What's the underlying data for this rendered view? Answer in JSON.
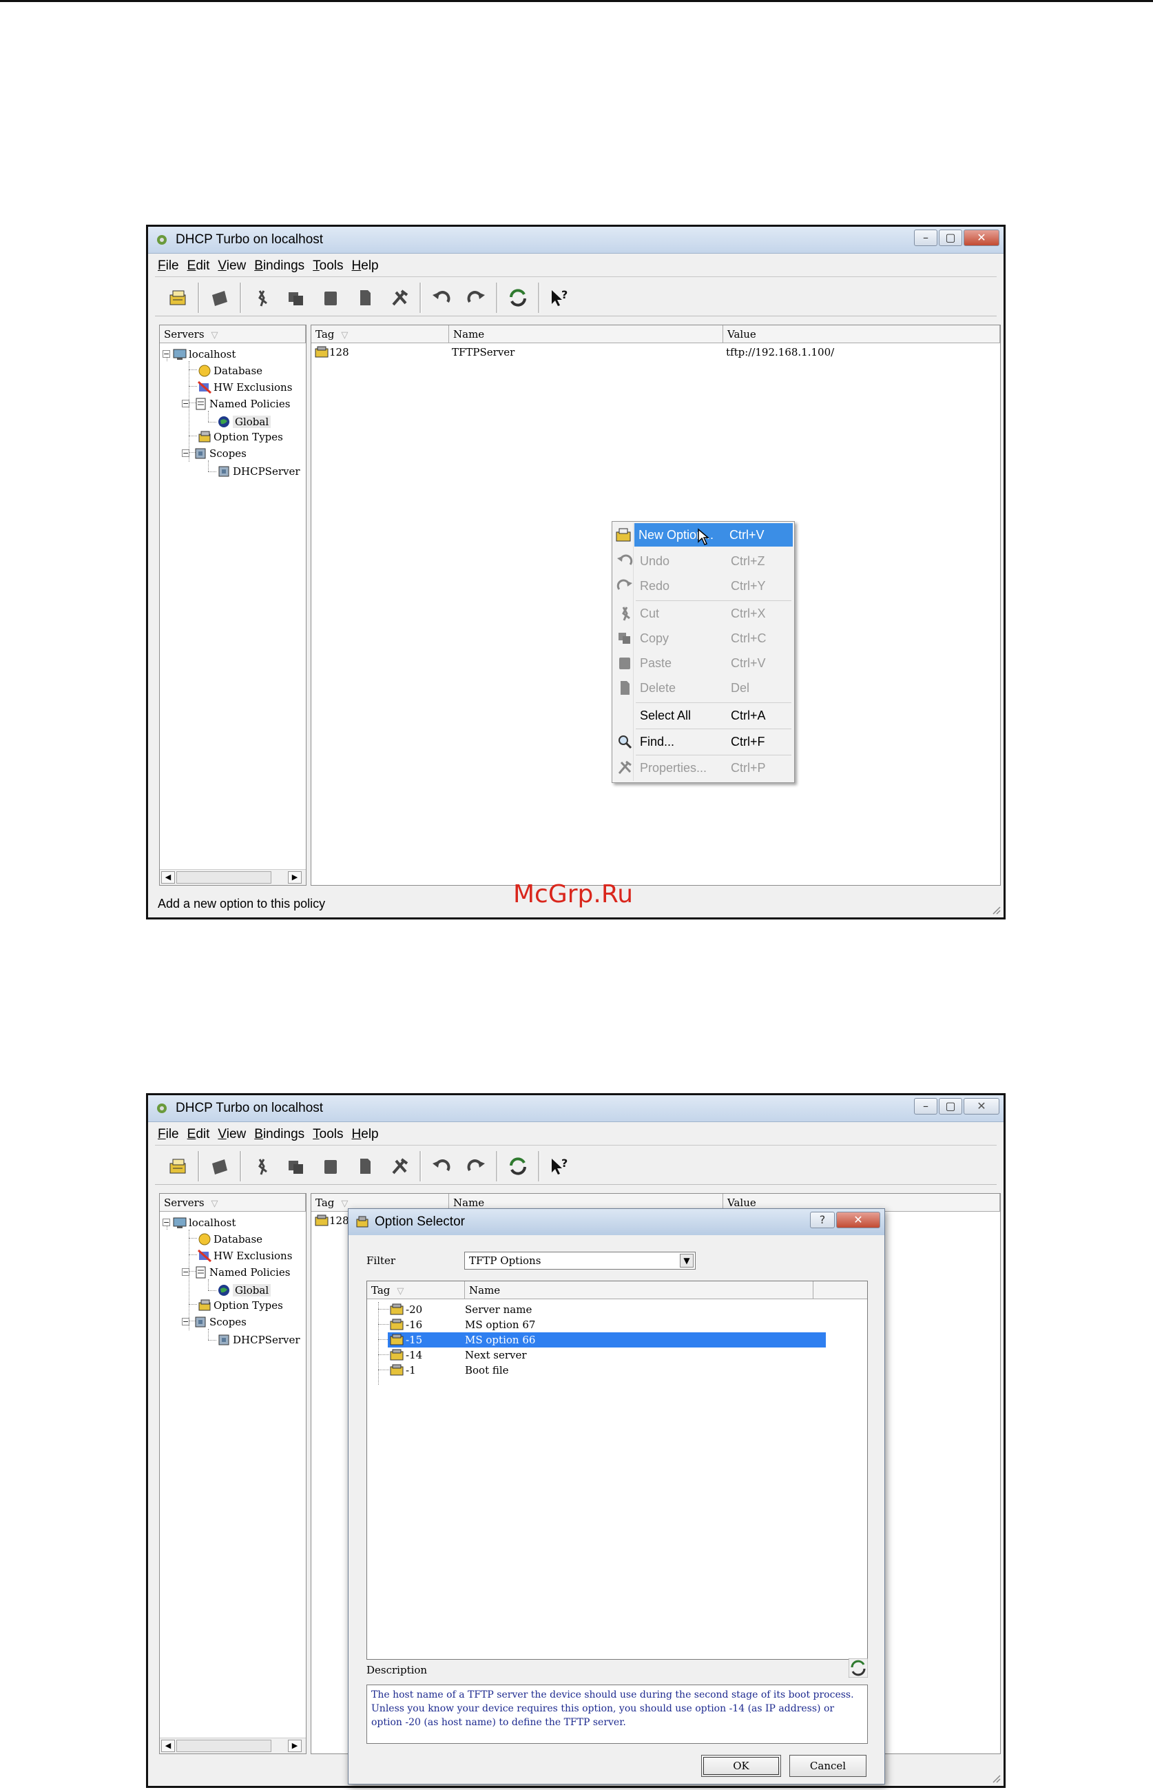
{
  "window1": {
    "title": "DHCP Turbo on localhost",
    "menu": [
      {
        "label": "File",
        "u": "F",
        "rest": "ile"
      },
      {
        "label": "Edit",
        "u": "E",
        "rest": "dit"
      },
      {
        "label": "View",
        "u": "V",
        "rest": "iew"
      },
      {
        "label": "Bindings",
        "u": "B",
        "rest": "indings"
      },
      {
        "label": "Tools",
        "u": "T",
        "rest": "ools"
      },
      {
        "label": "Help",
        "u": "H",
        "rest": "elp"
      }
    ],
    "tree_header": "Servers",
    "tree": {
      "root": "localhost",
      "database": "Database",
      "hw_exclusions": "HW Exclusions",
      "named_policies": "Named Policies",
      "global": "Global",
      "option_types": "Option Types",
      "scopes": "Scopes",
      "dhcpserver": "DHCPServer"
    },
    "columns": {
      "tag": "Tag",
      "name": "Name",
      "value": "Value"
    },
    "row": {
      "tag": "128",
      "name": "TFTPServer",
      "value": "tftp://192.168.1.100/"
    },
    "context_menu": [
      {
        "label": "New Option...",
        "key": "Ctrl+V"
      },
      {
        "label": "Undo",
        "key": "Ctrl+Z"
      },
      {
        "label": "Redo",
        "key": "Ctrl+Y"
      },
      {
        "label": "Cut",
        "key": "Ctrl+X"
      },
      {
        "label": "Copy",
        "key": "Ctrl+C"
      },
      {
        "label": "Paste",
        "key": "Ctrl+V"
      },
      {
        "label": "Delete",
        "key": "Del"
      },
      {
        "label": "Select All",
        "key": "Ctrl+A"
      },
      {
        "label": "Find...",
        "key": "Ctrl+F"
      },
      {
        "label": "Properties...",
        "key": "Ctrl+P"
      }
    ],
    "status": "Add a new option to this policy",
    "watermark": "McGrp.Ru"
  },
  "window2": {
    "title": "DHCP Turbo on localhost",
    "row_tag": "128",
    "dialog": {
      "title": "Option Selector",
      "filter_label": "Filter",
      "filter_value": "TFTP Options",
      "list_columns": {
        "tag": "Tag",
        "name": "Name"
      },
      "items": [
        {
          "tag": "-20",
          "name": "Server name"
        },
        {
          "tag": "-16",
          "name": "MS option 67"
        },
        {
          "tag": "-15",
          "name": "MS option 66"
        },
        {
          "tag": "-14",
          "name": "Next server"
        },
        {
          "tag": "-1",
          "name": "Boot file"
        }
      ],
      "selected_index": 2,
      "description_label": "Description",
      "description": "The host name of a TFTP server the device should use during the second stage of its boot process. Unless you know your device requires this option, you should use option -14 (as IP address) or option -20 (as host name) to define the TFTP server.",
      "ok": "OK",
      "cancel": "Cancel"
    }
  },
  "colors": {
    "highlight": "#3b8ee6",
    "selection": "#2f7ff0",
    "watermark": "#d9261c",
    "description_text": "#1d2a8f"
  }
}
